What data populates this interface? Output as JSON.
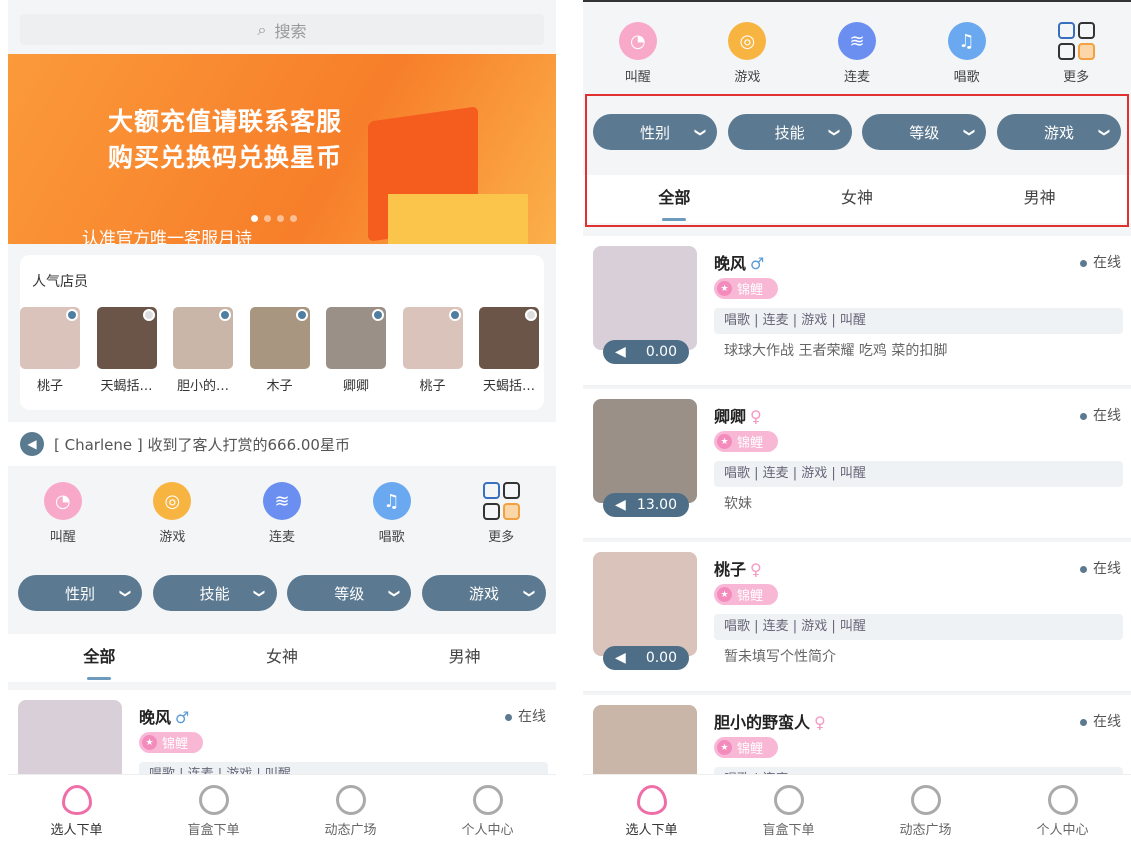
{
  "search": {
    "placeholder": "搜索"
  },
  "banner": {
    "line1": "大额充值请联系客服",
    "line2": "购买兑换码兑换星币",
    "sub": "认准官方唯一客服月诗"
  },
  "popular": {
    "title": "人气店员",
    "staff": [
      {
        "name": "桃子",
        "online": true,
        "color": "#d9c3bb"
      },
      {
        "name": "天蝎括…",
        "online": false,
        "color": "#6b5548"
      },
      {
        "name": "胆小的…",
        "online": true,
        "color": "#c9b6a8"
      },
      {
        "name": "木子",
        "online": true,
        "color": "#a89680"
      },
      {
        "name": "卿卿",
        "online": true,
        "color": "#9a9088"
      },
      {
        "name": "桃子",
        "online": true,
        "color": "#d9c3bb"
      },
      {
        "name": "天蝎括…",
        "online": false,
        "color": "#6b5548"
      }
    ]
  },
  "notice": {
    "text": "[ Charlene ] 收到了客人打赏的666.00星币"
  },
  "categories": [
    {
      "label": "叫醒",
      "icon": "alarm-clock-icon",
      "color": "#f8a8c8"
    },
    {
      "label": "游戏",
      "icon": "game-icon",
      "color": "#f8b440"
    },
    {
      "label": "连麦",
      "icon": "voice-wave-icon",
      "color": "#6a8ff0"
    },
    {
      "label": "唱歌",
      "icon": "music-note-icon",
      "color": "#6aa8f0"
    },
    {
      "label": "更多",
      "icon": "grid-more-icon",
      "color": "#333333"
    }
  ],
  "filters": [
    "性别",
    "技能",
    "等级",
    "游戏"
  ],
  "tabs": [
    "全部",
    "女神",
    "男神"
  ],
  "items": [
    {
      "name": "晚风",
      "gender": "♂",
      "gcolor": "#5b9bd5",
      "status": "在线",
      "badge": "锦鲤",
      "skills": "唱歌 | 连麦 | 游戏 | 叫醒",
      "intro": "球球大作战 王者荣耀 吃鸡 菜的扣脚",
      "price": "0.00",
      "color": "#d8cfd8"
    },
    {
      "name": "卿卿",
      "gender": "♀",
      "gcolor": "#f59ac4",
      "status": "在线",
      "badge": "锦鲤",
      "skills": "唱歌 | 连麦 | 游戏 | 叫醒",
      "intro": "软妹",
      "price": "13.00",
      "color": "#9a9088"
    },
    {
      "name": "桃子",
      "gender": "♀",
      "gcolor": "#f59ac4",
      "status": "在线",
      "badge": "锦鲤",
      "skills": "唱歌 | 连麦 | 游戏 | 叫醒",
      "intro": "暂未填写个性简介",
      "price": "0.00",
      "color": "#d9c3bb"
    },
    {
      "name": "胆小的野蛮人",
      "gender": "♀",
      "gcolor": "#f59ac4",
      "status": "在线",
      "badge": "锦鲤",
      "skills": "唱歌 | 连麦",
      "intro": "",
      "price": "",
      "color": "#c9b6a8"
    }
  ],
  "nav": [
    "选人下单",
    "盲盒下单",
    "动态广场",
    "个人中心"
  ],
  "colors": {
    "accent": "#5b7990",
    "highlight": "#e03030",
    "pink": "#f06ea8"
  }
}
